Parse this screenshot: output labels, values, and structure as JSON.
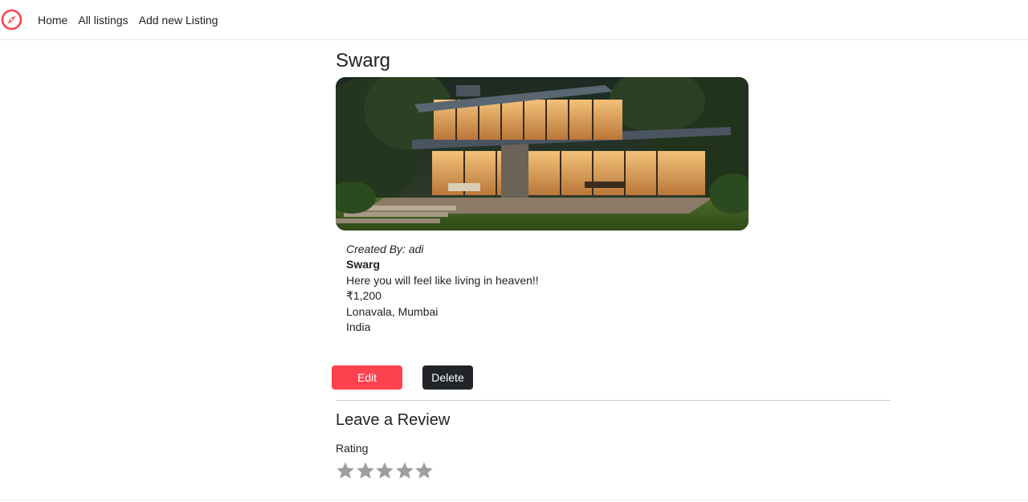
{
  "nav": {
    "logo_icon": "compass-icon",
    "brand_color": "#fe424d",
    "links": [
      {
        "label": "Home"
      },
      {
        "label": "All listings"
      },
      {
        "label": "Add new Listing"
      }
    ]
  },
  "listing": {
    "title": "Swarg",
    "image_icon": "listing-house-photo",
    "owner": "Created By: adi",
    "name": "Swarg",
    "description": "Here you will feel like living in heaven!!",
    "price": "₹1,200",
    "location": "Lonavala, Mumbai",
    "country": "India"
  },
  "actions": {
    "edit_label": "Edit",
    "delete_label": "Delete",
    "edit_color": "#fe424d",
    "delete_color": "#212529"
  },
  "review": {
    "heading": "Leave a Review",
    "rating_label": "Rating",
    "star_icon": "star-icon",
    "star_color": "#9e9e9e",
    "rating": 0,
    "max_rating": 5
  }
}
